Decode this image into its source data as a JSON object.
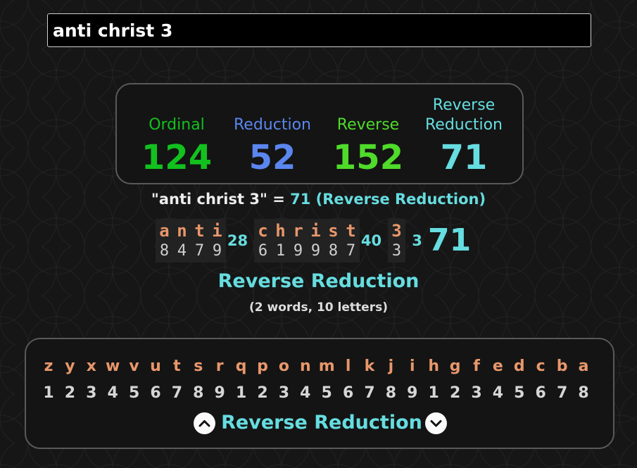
{
  "search": {
    "value": "anti christ 3"
  },
  "ciphers": [
    {
      "name": "Ordinal",
      "value": "124",
      "color": "#12c11e"
    },
    {
      "name": "Reduction",
      "value": "52",
      "color": "#5b86ef"
    },
    {
      "name": "Reverse",
      "value": "152",
      "color": "#4fdb2a"
    },
    {
      "name": "Reverse\nReduction",
      "value": "71",
      "color": "#66dde0"
    }
  ],
  "result": {
    "phrase": "\"anti christ 3\" =",
    "value": "71",
    "cipher": "(Reverse Reduction)"
  },
  "breakdown": {
    "words": [
      {
        "letters": [
          {
            "ch": "a",
            "n": "8"
          },
          {
            "ch": "n",
            "n": "4"
          },
          {
            "ch": "t",
            "n": "7"
          },
          {
            "ch": "i",
            "n": "9"
          }
        ],
        "sum": "28"
      },
      {
        "letters": [
          {
            "ch": "c",
            "n": "6"
          },
          {
            "ch": "h",
            "n": "1"
          },
          {
            "ch": "r",
            "n": "9"
          },
          {
            "ch": "i",
            "n": "9"
          },
          {
            "ch": "s",
            "n": "8"
          },
          {
            "ch": "t",
            "n": "7"
          }
        ],
        "sum": "40"
      },
      {
        "letters": [
          {
            "ch": "3",
            "n": "3"
          }
        ],
        "sum": "3"
      }
    ],
    "total": "71"
  },
  "cipher_title": "Reverse Reduction",
  "counts": "(2 words, 10 letters)",
  "chart": {
    "letters": [
      "z",
      "y",
      "x",
      "w",
      "v",
      "u",
      "t",
      "s",
      "r",
      "q",
      "p",
      "o",
      "n",
      "m",
      "l",
      "k",
      "j",
      "i",
      "h",
      "g",
      "f",
      "e",
      "d",
      "c",
      "b",
      "a"
    ],
    "numbers": [
      "1",
      "2",
      "3",
      "4",
      "5",
      "6",
      "7",
      "8",
      "9",
      "1",
      "2",
      "3",
      "4",
      "5",
      "6",
      "7",
      "8",
      "9",
      "1",
      "2",
      "3",
      "4",
      "5",
      "6",
      "7",
      "8"
    ],
    "label": "Reverse Reduction",
    "prev_icon": "chevron-up-icon",
    "next_icon": "chevron-down-icon"
  },
  "colors": {
    "accent": "#66dde0",
    "letter": "#e8976b",
    "background": "#161616"
  }
}
